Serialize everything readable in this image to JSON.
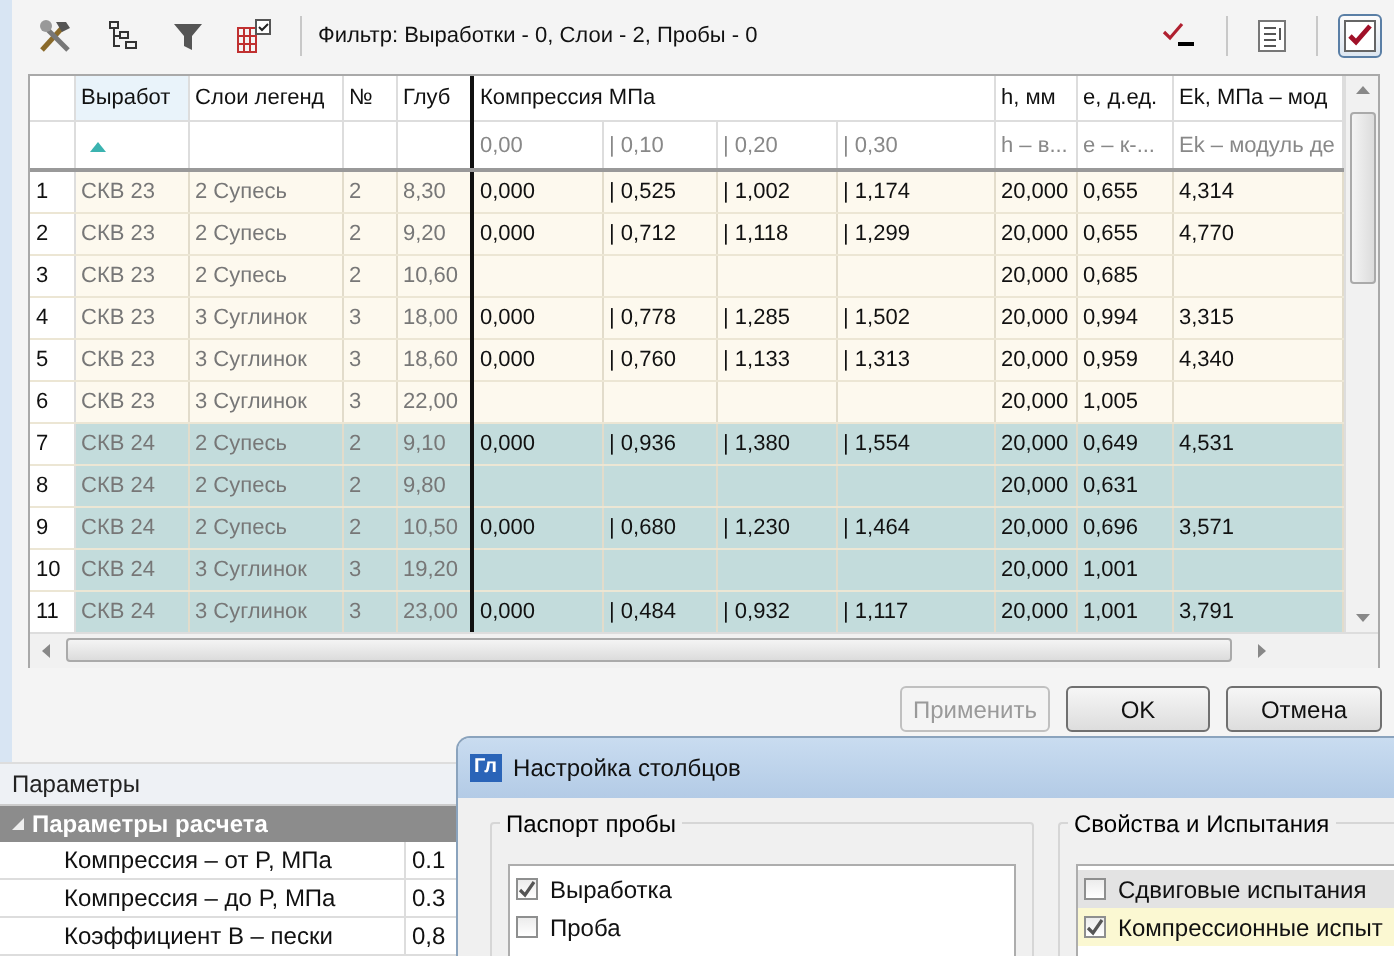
{
  "toolbar": {
    "filter_text": "Фильтр: Выработки - 0, Слои - 2, Пробы - 0",
    "toggle_pressed": true
  },
  "grid": {
    "group_header": "Компрессия МПа",
    "columns": [
      {
        "label": "Выработ",
        "sorted_ascending": true
      },
      {
        "label": "Слои легенд"
      },
      {
        "label": "№"
      },
      {
        "label": "Глуб"
      },
      {
        "sub": "0,00"
      },
      {
        "sub": "| 0,10"
      },
      {
        "sub": "| 0,20"
      },
      {
        "sub": "| 0,30"
      },
      {
        "label": "h, мм",
        "sub": "h – в..."
      },
      {
        "label": "е, д.ед.",
        "sub": "е – к-..."
      },
      {
        "label": "Ek, МПа – мод",
        "sub": "Ek – модуль де"
      }
    ],
    "rows": [
      {
        "number": "1",
        "color": "#fdf9ee",
        "cells": [
          "СКВ 23",
          "2 Супесь",
          "2",
          "8,30",
          "0,000",
          "| 0,525",
          "| 1,002",
          "| 1,174",
          "20,000",
          "0,655",
          "4,314"
        ]
      },
      {
        "number": "2",
        "color": "#fdf9ee",
        "cells": [
          "СКВ 23",
          "2 Супесь",
          "2",
          "9,20",
          "0,000",
          "| 0,712",
          "| 1,118",
          "| 1,299",
          "20,000",
          "0,655",
          "4,770"
        ]
      },
      {
        "number": "3",
        "color": "#fdf9ee",
        "cells": [
          "СКВ 23",
          "2 Супесь",
          "2",
          "10,60",
          null,
          null,
          null,
          null,
          "20,000",
          "0,685",
          null
        ]
      },
      {
        "number": "4",
        "color": "#fdf9ee",
        "cells": [
          "СКВ 23",
          "3 Суглинок",
          "3",
          "18,00",
          "0,000",
          "| 0,778",
          "| 1,285",
          "| 1,502",
          "20,000",
          "0,994",
          "3,315"
        ]
      },
      {
        "number": "5",
        "color": "#fdf9ee",
        "cells": [
          "СКВ 23",
          "3 Суглинок",
          "3",
          "18,60",
          "0,000",
          "| 0,760",
          "| 1,133",
          "| 1,313",
          "20,000",
          "0,959",
          "4,340"
        ]
      },
      {
        "number": "6",
        "color": "#fdf9ee",
        "cells": [
          "СКВ 23",
          "3 Суглинок",
          "3",
          "22,00",
          null,
          null,
          null,
          null,
          "20,000",
          "1,005",
          null
        ]
      },
      {
        "number": "7",
        "color": "#c3dcdc",
        "cells": [
          "СКВ 24",
          "2 Супесь",
          "2",
          "9,10",
          "0,000",
          "| 0,936",
          "| 1,380",
          "| 1,554",
          "20,000",
          "0,649",
          "4,531"
        ]
      },
      {
        "number": "8",
        "color": "#c3dcdc",
        "cells": [
          "СКВ 24",
          "2 Супесь",
          "2",
          "9,80",
          null,
          null,
          null,
          null,
          "20,000",
          "0,631",
          null
        ]
      },
      {
        "number": "9",
        "color": "#c3dcdc",
        "cells": [
          "СКВ 24",
          "2 Супесь",
          "2",
          "10,50",
          "0,000",
          "| 0,680",
          "| 1,230",
          "| 1,464",
          "20,000",
          "0,696",
          "3,571"
        ]
      },
      {
        "number": "10",
        "color": "#c3dcdc",
        "cells": [
          "СКВ 24",
          "3 Суглинок",
          "3",
          "19,20",
          null,
          null,
          null,
          null,
          "20,000",
          "1,001",
          null
        ]
      },
      {
        "number": "11",
        "color": "#c3dcdc",
        "cells": [
          "СКВ 24",
          "3 Суглинок",
          "3",
          "23,00",
          "0,000",
          "| 0,484",
          "| 0,932",
          "| 1,117",
          "20,000",
          "1,001",
          "3,791"
        ]
      }
    ]
  },
  "buttons": [
    {
      "label": "Применить",
      "disabled": true
    },
    {
      "label": "OK",
      "disabled": false
    },
    {
      "label": "Отмена",
      "disabled": false
    }
  ],
  "parameters": {
    "title": "Параметры",
    "group": {
      "label": "Параметры расчета",
      "expanded": true,
      "rows": [
        {
          "name": "Компрессия – от P, МПа",
          "value": "0.1"
        },
        {
          "name": "Компрессия – до P, МПа",
          "value": "0.3"
        },
        {
          "name": "Коэффициент B – пески",
          "value": "0,8"
        }
      ]
    }
  },
  "dialog": {
    "icon_text": "Гл",
    "title": "Настройка столбцов",
    "groups": [
      {
        "title": "Паспорт пробы",
        "items": [
          {
            "label": "Выработка",
            "checked": true
          },
          {
            "label": "Проба",
            "checked": false
          }
        ]
      },
      {
        "title": "Свойства и Испытания",
        "items": [
          {
            "label": "Сдвиговые испытания",
            "checked": false,
            "color": "#e3e3e3"
          },
          {
            "label": "Компрессионные испыт",
            "checked": true,
            "color": "#fbf8d2"
          }
        ]
      }
    ]
  }
}
